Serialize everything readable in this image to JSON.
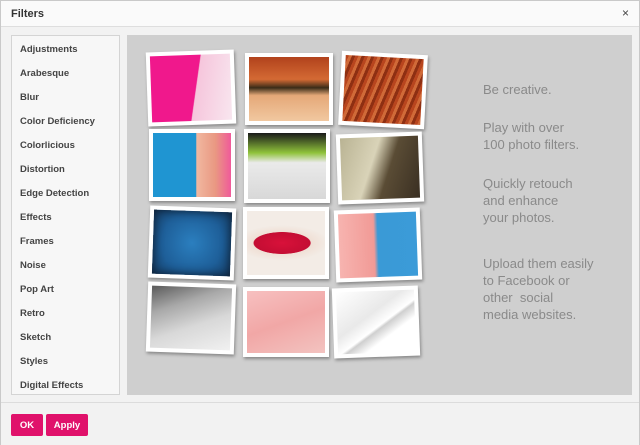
{
  "dialog": {
    "title": "Filters",
    "close_glyph": "×",
    "close_icon": "close-icon"
  },
  "sidebar": {
    "items": [
      {
        "label": "Adjustments"
      },
      {
        "label": "Arabesque"
      },
      {
        "label": "Blur"
      },
      {
        "label": "Color Deficiency"
      },
      {
        "label": "Colorlicious"
      },
      {
        "label": "Distortion"
      },
      {
        "label": "Edge Detection"
      },
      {
        "label": "Effects"
      },
      {
        "label": "Frames"
      },
      {
        "label": "Noise"
      },
      {
        "label": "Pop Art"
      },
      {
        "label": "Retro"
      },
      {
        "label": "Sketch"
      },
      {
        "label": "Styles"
      },
      {
        "label": "Digital Effects"
      }
    ]
  },
  "promo": {
    "line1": "Be creative.",
    "line2": "Play with over\n100 photo filters.",
    "line3": "Quickly retouch\nand enhance\nyour photos.",
    "line4": "Upload them easily\nto Facebook or\nother  social\nmedia websites."
  },
  "footer": {
    "ok_label": "OK",
    "apply_label": "Apply"
  },
  "colors": {
    "accent": "#e0126b",
    "preview_bg": "#cfcfcf",
    "promo_text": "#8a8a8a"
  }
}
